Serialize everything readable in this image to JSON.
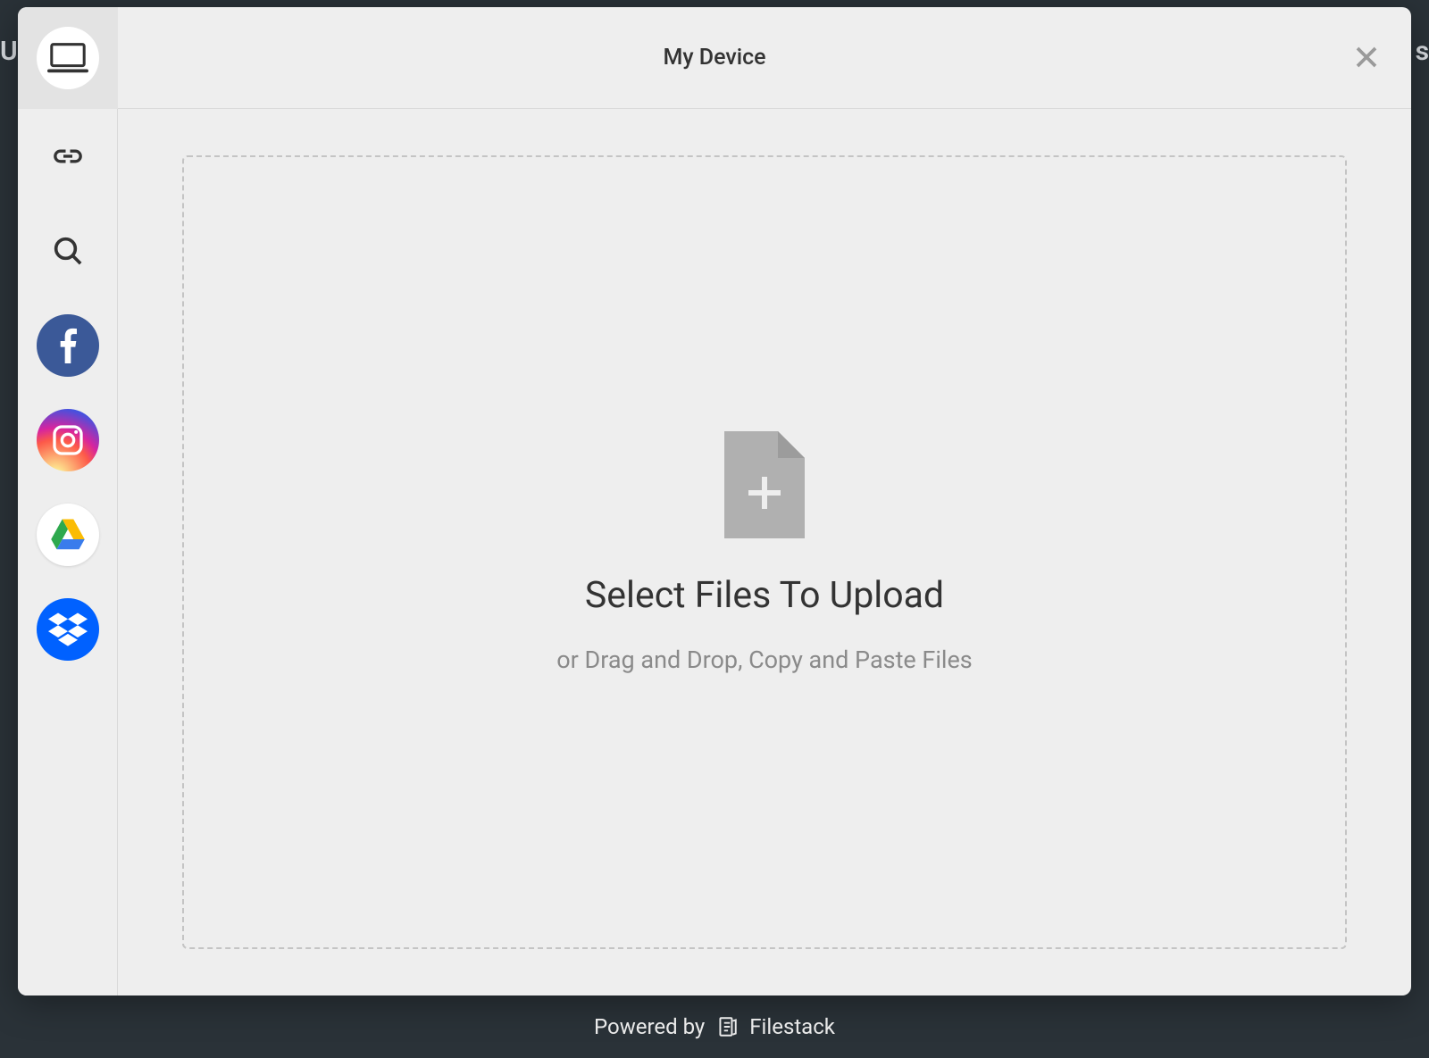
{
  "header": {
    "title": "My Device"
  },
  "sidebar": {
    "sources": [
      {
        "name": "my-device",
        "icon": "computer-icon",
        "active": true
      },
      {
        "name": "link",
        "icon": "link-icon"
      },
      {
        "name": "web-search",
        "icon": "search-icon"
      },
      {
        "name": "facebook",
        "icon": "facebook-icon"
      },
      {
        "name": "instagram",
        "icon": "instagram-icon"
      },
      {
        "name": "google-drive",
        "icon": "google-drive-icon"
      },
      {
        "name": "dropbox",
        "icon": "dropbox-icon"
      }
    ]
  },
  "dropzone": {
    "title": "Select Files To Upload",
    "subtitle": "or Drag and Drop, Copy and Paste Files"
  },
  "footer": {
    "prefix": "Powered by",
    "brand": "Filestack"
  },
  "background": {
    "left_peek": "Up",
    "right_peek": "s",
    "hidden_powered": "Powered by"
  }
}
